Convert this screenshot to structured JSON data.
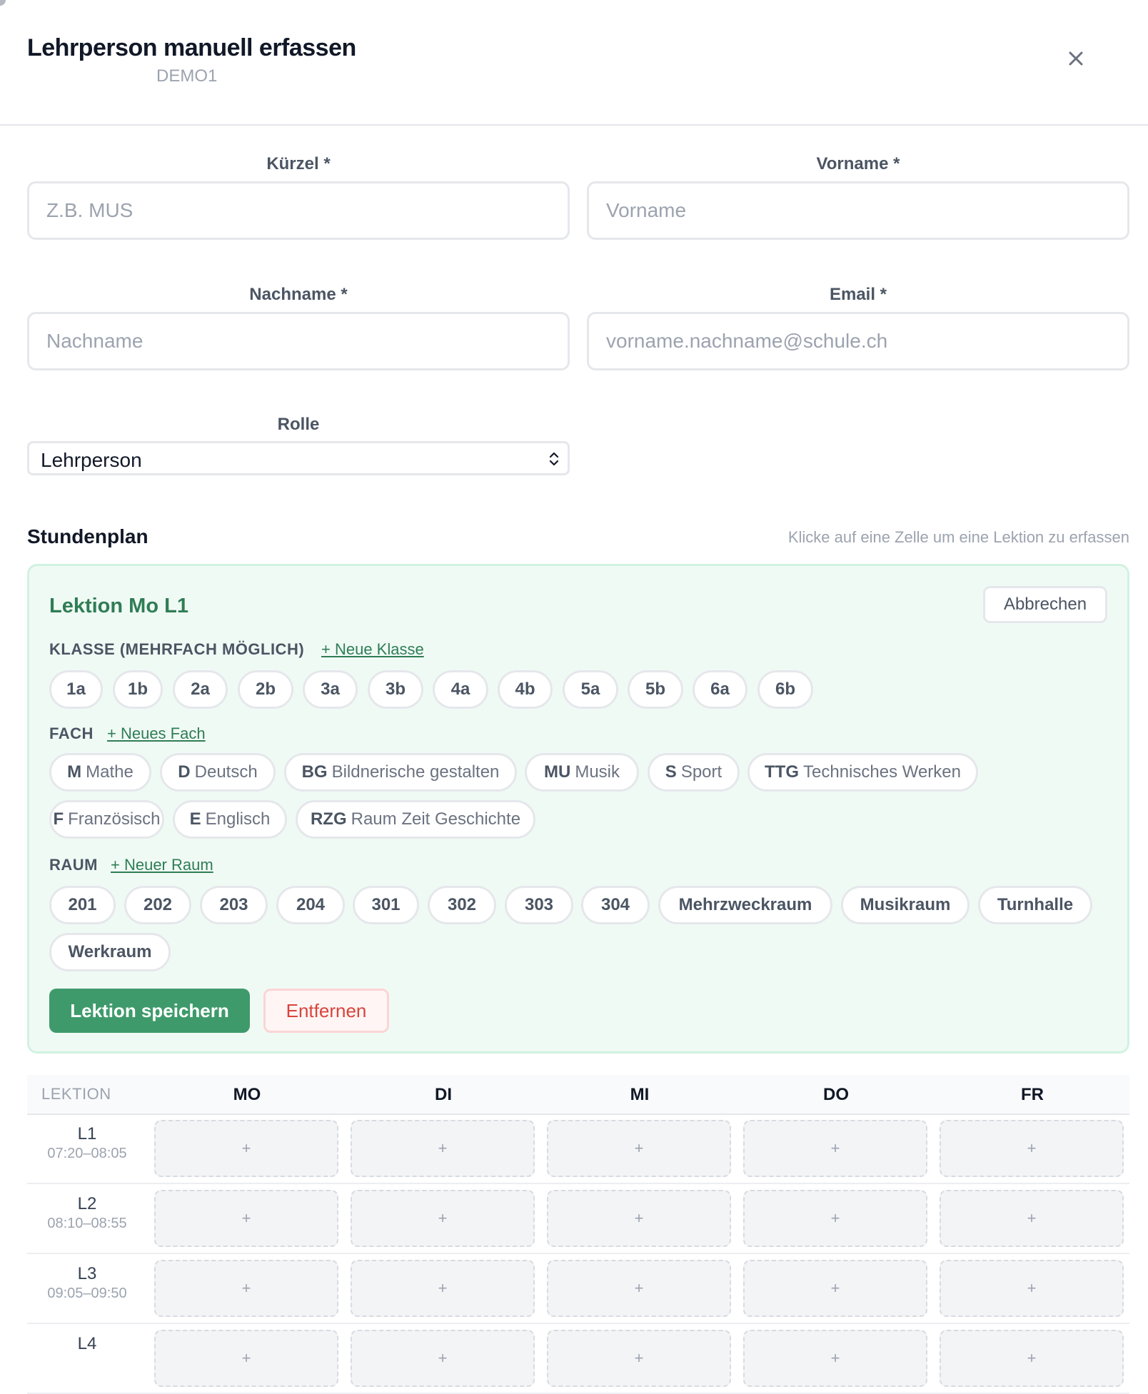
{
  "modal": {
    "title": "Lehrperson manuell erfassen",
    "subtitle": "DEMO1",
    "close_icon": "close-icon"
  },
  "form": {
    "kuerzel": {
      "label": "Kürzel *",
      "placeholder": "Z.B. MUS",
      "value": ""
    },
    "vorname": {
      "label": "Vorname *",
      "placeholder": "Vorname",
      "value": ""
    },
    "nachname": {
      "label": "Nachname *",
      "placeholder": "Nachname",
      "value": ""
    },
    "email": {
      "label": "Email *",
      "placeholder": "vorname.nachname@schule.ch",
      "value": ""
    },
    "rolle": {
      "label": "Rolle",
      "value": "Lehrperson"
    }
  },
  "schedule": {
    "title": "Stundenplan",
    "hint": "Klicke auf eine Zelle um eine Lektion zu erfassen",
    "editor": {
      "title": "Lektion Mo L1",
      "cancel_label": "Abbrechen",
      "klasse_label": "KLASSE (MEHRFACH MÖGLICH)",
      "klasse_add": "+ Neue Klasse",
      "klassen": [
        "1a",
        "1b",
        "2a",
        "2b",
        "3a",
        "3b",
        "4a",
        "4b",
        "5a",
        "5b",
        "6a",
        "6b"
      ],
      "fach_label": "FACH",
      "fach_add": "+ Neues Fach",
      "faecher": [
        {
          "abbr": "M",
          "name": "Mathe"
        },
        {
          "abbr": "D",
          "name": "Deutsch"
        },
        {
          "abbr": "BG",
          "name": "Bildnerische gestalten"
        },
        {
          "abbr": "MU",
          "name": "Musik"
        },
        {
          "abbr": "S",
          "name": "Sport"
        },
        {
          "abbr": "TTG",
          "name": "Technisches Werken"
        },
        {
          "abbr": "F",
          "name": "Französisch"
        },
        {
          "abbr": "E",
          "name": "Englisch"
        },
        {
          "abbr": "RZG",
          "name": "Raum Zeit Geschichte"
        }
      ],
      "raum_label": "RAUM",
      "raum_add": "+ Neuer Raum",
      "raeume": [
        "201",
        "202",
        "203",
        "204",
        "301",
        "302",
        "303",
        "304",
        "Mehrzweckraum",
        "Musikraum",
        "Turnhalle",
        "Werkraum"
      ],
      "save_label": "Lektion speichern",
      "remove_label": "Entfernen"
    },
    "table": {
      "lesson_header": "LEKTION",
      "days": [
        "MO",
        "DI",
        "MI",
        "DO",
        "FR"
      ],
      "cell_symbol": "+",
      "lessons": [
        {
          "label": "L1",
          "time": "07:20–08:05"
        },
        {
          "label": "L2",
          "time": "08:10–08:55"
        },
        {
          "label": "L3",
          "time": "09:05–09:50"
        },
        {
          "label": "L4",
          "time": ""
        }
      ]
    }
  },
  "colors": {
    "accent": "#3f9a6b",
    "panel_bg": "#f0faf5",
    "danger": "#d9443a"
  }
}
